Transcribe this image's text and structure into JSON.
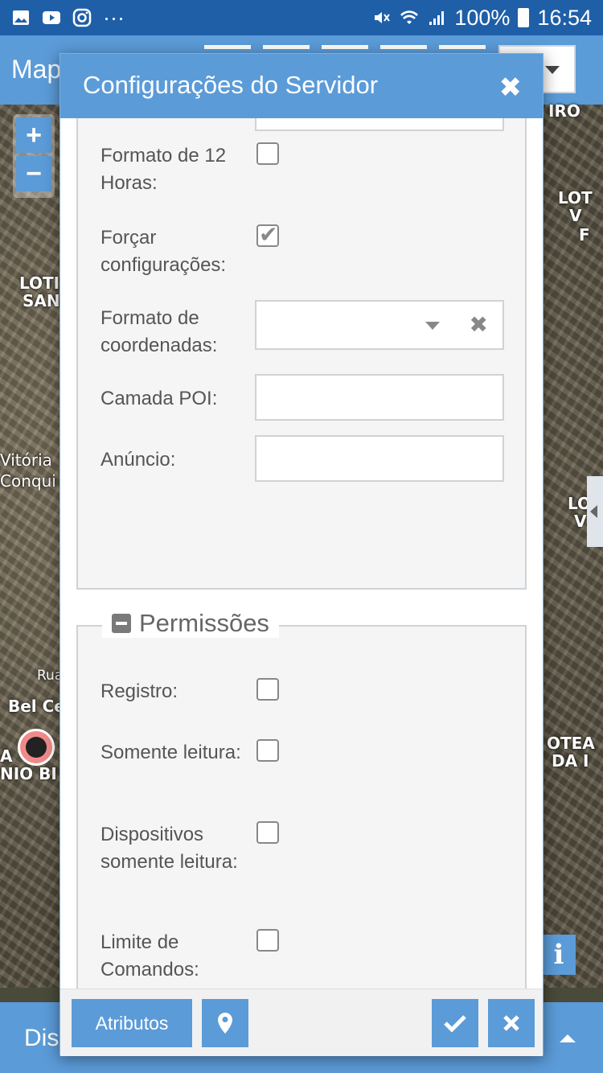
{
  "status_bar": {
    "battery": "100%",
    "time": "16:54",
    "dots": "···"
  },
  "app": {
    "title": "Map",
    "bottom_label": "Dis"
  },
  "map_labels": [
    "IRO",
    "LOT",
    "V",
    "F",
    "LOTI",
    "SAN",
    "Vitória",
    "Conqui",
    "LO",
    "V",
    "Rua",
    "Bel Ce",
    "A",
    "NIO BI",
    "OTEA",
    "DA I"
  ],
  "zoom": {
    "in": "+",
    "out": "−"
  },
  "info_label": "i",
  "modal": {
    "title": "Configurações do Servidor",
    "close_icon": "✖",
    "fields": {
      "twelve_hour": {
        "label": "Formato de 12 Horas:",
        "checked": false
      },
      "force_settings": {
        "label": "Forçar configurações:",
        "checked": true
      },
      "coord_format": {
        "label": "Formato de coordenadas:",
        "value": ""
      },
      "poi_layer": {
        "label": "Camada POI:",
        "value": ""
      },
      "announcement": {
        "label": "Anúncio:",
        "value": ""
      }
    },
    "permissions": {
      "title": "Permissões",
      "registration": {
        "label": "Registro:",
        "checked": false
      },
      "readonly": {
        "label": "Somente leitura:",
        "checked": false
      },
      "devices_readonly": {
        "label": "Dispositivos somente leitura:",
        "checked": false
      },
      "command_limit": {
        "label": "Limite de Comandos:",
        "checked": false
      }
    },
    "footer": {
      "attributes_label": "Atributos",
      "location_icon": "map-marker-icon",
      "save_icon": "check-icon",
      "cancel_icon": "close-icon"
    }
  },
  "colors": {
    "primary": "#5b9bd8",
    "status_bar": "#1f5fa8"
  }
}
